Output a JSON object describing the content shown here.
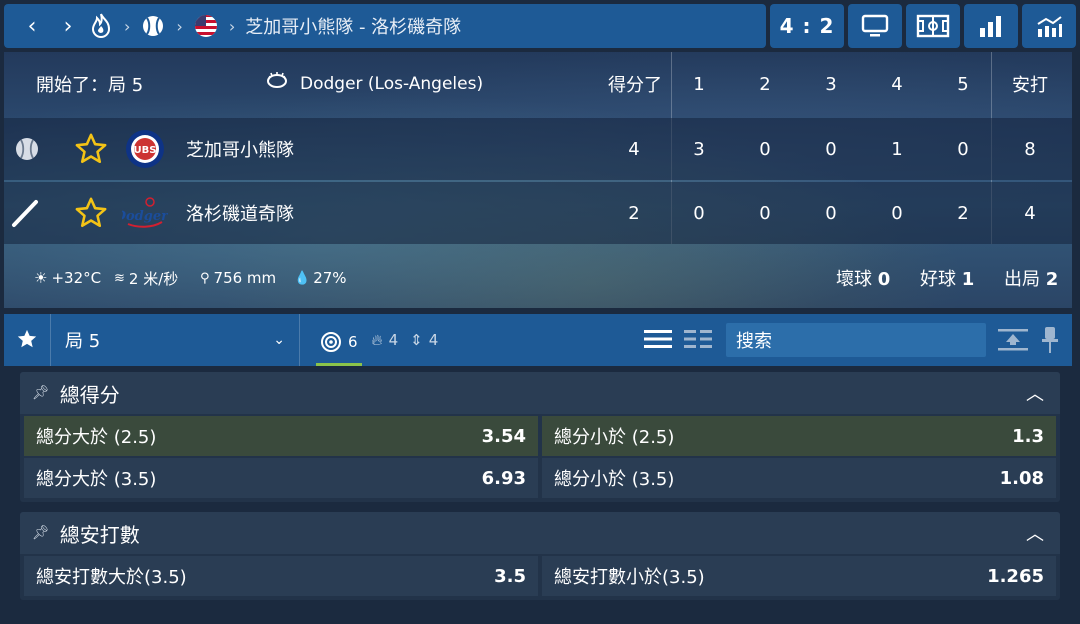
{
  "header": {
    "breadcrumb_title": "芝加哥小熊隊 - 洛杉磯奇隊",
    "score": "4 : 2"
  },
  "scoreboard": {
    "status": "開始了：局 5",
    "venue": "Dodger (Los-Angeles)",
    "columns": [
      "得分了",
      "1",
      "2",
      "3",
      "4",
      "5",
      "安打"
    ],
    "teams": [
      {
        "name": "芝加哥小熊隊",
        "values": [
          "4",
          "3",
          "0",
          "0",
          "1",
          "0",
          "8"
        ]
      },
      {
        "name": "洛杉磯道奇隊",
        "values": [
          "2",
          "0",
          "0",
          "0",
          "0",
          "2",
          "4"
        ]
      }
    ],
    "weather": {
      "temp": "+32°C",
      "wind": "2 米/秒",
      "pressure": "756 mm",
      "humidity": "27%"
    },
    "count": {
      "balls_label": "壞球",
      "balls": "0",
      "strikes_label": "好球",
      "strikes": "1",
      "outs_label": "出局",
      "outs": "2"
    }
  },
  "tabs": {
    "period": "局 5",
    "counter_all": "6",
    "counter_hot": "4",
    "counter_move": "4",
    "search_placeholder": "搜索"
  },
  "markets": [
    {
      "title": "總得分",
      "rows": [
        [
          {
            "label": "總分大於 (2.5)",
            "value": "3.54"
          },
          {
            "label": "總分小於 (2.5)",
            "value": "1.3"
          }
        ],
        [
          {
            "label": "總分大於 (3.5)",
            "value": "6.93"
          },
          {
            "label": "總分小於 (3.5)",
            "value": "1.08"
          }
        ]
      ]
    },
    {
      "title": "總安打數",
      "rows": [
        [
          {
            "label": "總安打數大於(3.5)",
            "value": "3.5"
          },
          {
            "label": "總安打數小於(3.5)",
            "value": "1.265"
          }
        ]
      ]
    }
  ]
}
